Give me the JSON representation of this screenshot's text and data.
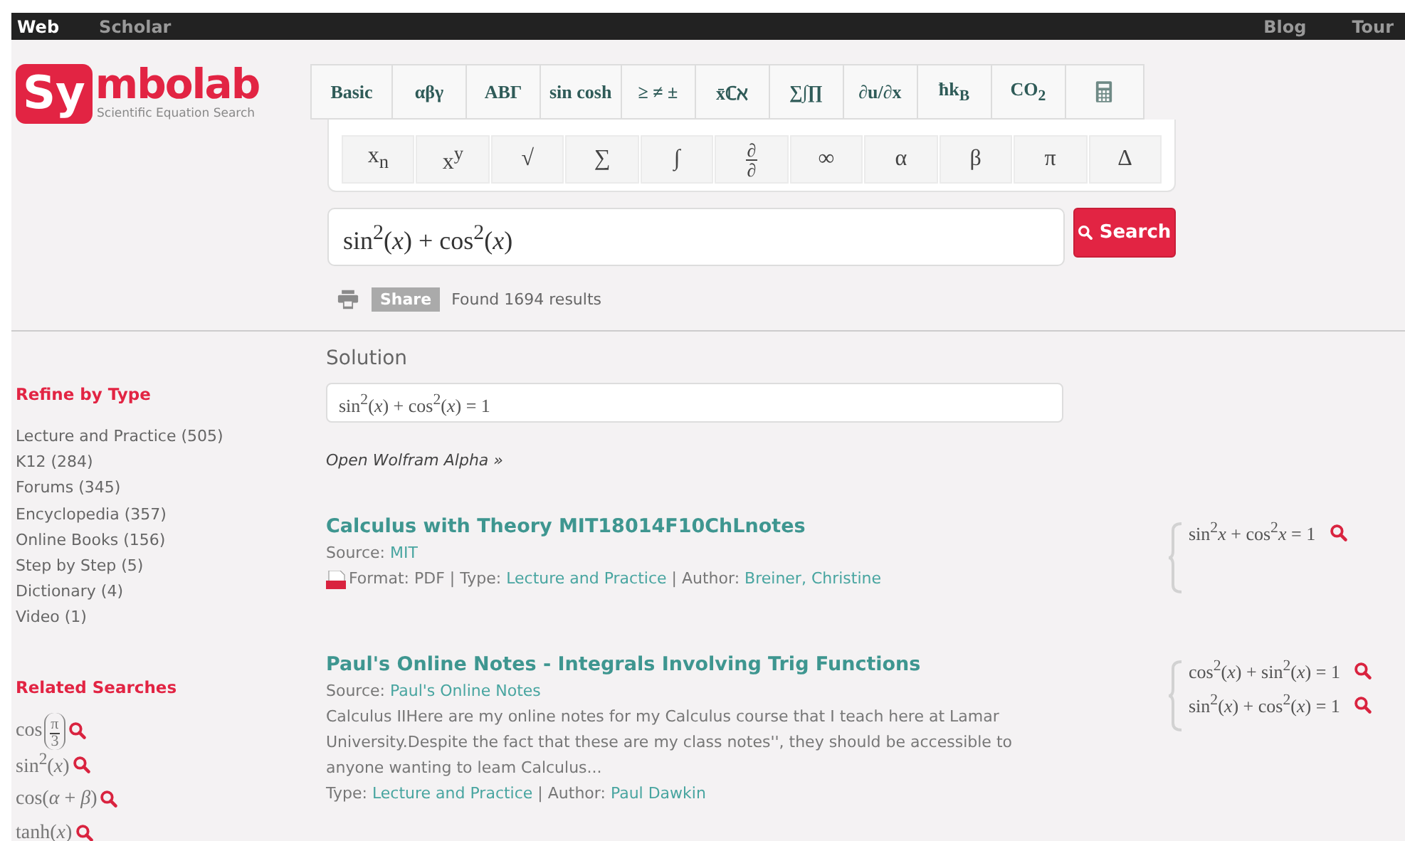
{
  "top_nav": {
    "left": [
      {
        "label": "Web",
        "selected": true
      },
      {
        "label": "Scholar",
        "selected": false
      }
    ],
    "right": [
      {
        "label": "Blog"
      },
      {
        "label": "Tour"
      }
    ]
  },
  "logo": {
    "badge": "Sy",
    "rest": "mbolab",
    "tagline": "Scientific Equation Search"
  },
  "keyboard": {
    "tabs": [
      {
        "kind": "text",
        "label": "Basic"
      },
      {
        "kind": "text",
        "label": "αβγ"
      },
      {
        "kind": "text",
        "label": "ΑΒΓ"
      },
      {
        "kind": "text",
        "label": "sin cosh"
      },
      {
        "kind": "text",
        "label": "≥ ≠ ±"
      },
      {
        "kind": "text",
        "label": "x̄ℂℵ"
      },
      {
        "kind": "text",
        "label": "∑∫∏"
      },
      {
        "kind": "text",
        "label": "∂u/∂x"
      },
      {
        "kind": "text",
        "label": "ħk$_{B}$"
      },
      {
        "kind": "text",
        "label": "CO$_{2}$"
      },
      {
        "kind": "calculator"
      }
    ],
    "keys": [
      {
        "kind": "text",
        "label": "x$_{n}$"
      },
      {
        "kind": "text",
        "label": "x$^{y}$"
      },
      {
        "kind": "text",
        "label": "√"
      },
      {
        "kind": "text",
        "label": "∑"
      },
      {
        "kind": "text",
        "label": "∫"
      },
      {
        "kind": "fraction",
        "numerator": "∂",
        "denominator": "∂"
      },
      {
        "kind": "text",
        "label": "∞"
      },
      {
        "kind": "text",
        "label": "α"
      },
      {
        "kind": "text",
        "label": "β"
      },
      {
        "kind": "text",
        "label": "π"
      },
      {
        "kind": "text",
        "label": "Δ"
      }
    ]
  },
  "search": {
    "value": "sin$^{2}$(*x*) + cos$^{2}$(*x*)",
    "button": "Search"
  },
  "actions": {
    "share": "Share",
    "results": "Found 1694 results"
  },
  "sidebar": {
    "refine": {
      "title": "Refine by Type",
      "items": [
        "Lecture and Practice (505)",
        "K12 (284)",
        "Forums (345)",
        "Encyclopedia (357)",
        "Online Books (156)",
        "Step by Step (5)",
        "Dictionary (4)",
        "Video (1)"
      ]
    },
    "related": {
      "title": "Related Searches",
      "items": [
        {
          "kind": "fraction",
          "text": "cos",
          "numerator": "π",
          "denominator": "3"
        },
        {
          "kind": "plain",
          "text": "sin$^{2}$(*x*)"
        },
        {
          "kind": "plain",
          "text": "cos(*α* + *β*)"
        },
        {
          "kind": "plain",
          "text": "tanh(*x*)"
        }
      ]
    }
  },
  "solution": {
    "title": "Solution",
    "formula": "sin$^{2}$(*x*) + cos$^{2}$(*x*) = 1",
    "link": "Open Wolfram Alpha »"
  },
  "results": [
    {
      "title": "Calculus with Theory MIT18014F10ChLnotes",
      "source_label": "Source:",
      "source": "MIT",
      "pdf": true,
      "separator": "|",
      "meta": [
        {
          "label": "Format:",
          "value": "PDF",
          "link": false
        },
        {
          "label": "Type:",
          "value": "Lecture and Practice",
          "link": true
        },
        {
          "label": "Author:",
          "value": "Breiner, Christine",
          "link": true
        }
      ],
      "formulas": [
        "sin$^{2}$*x* + cos$^{2}$*x* = 1"
      ]
    },
    {
      "title": "Paul's Online Notes - Integrals Involving Trig Functions",
      "source_label": "Source:",
      "source": "Paul's Online Notes",
      "pdf": false,
      "snippet": "Calculus IIHere are my online notes for my Calculus course that I teach here at Lamar University.Despite the fact that these are my class notes'', they should be accessible to anyone wanting to leam Calculus...",
      "separator": "|",
      "meta": [
        {
          "label": "Type:",
          "value": "Lecture and Practice",
          "link": true
        },
        {
          "label": "Author:",
          "value": "Paul Dawkin",
          "link": true
        }
      ],
      "formulas": [
        "cos$^{2}$(*x*) + sin$^{2}$(*x*) = 1",
        "sin$^{2}$(*x*) + cos$^{2}$(*x*) = 1"
      ]
    }
  ]
}
